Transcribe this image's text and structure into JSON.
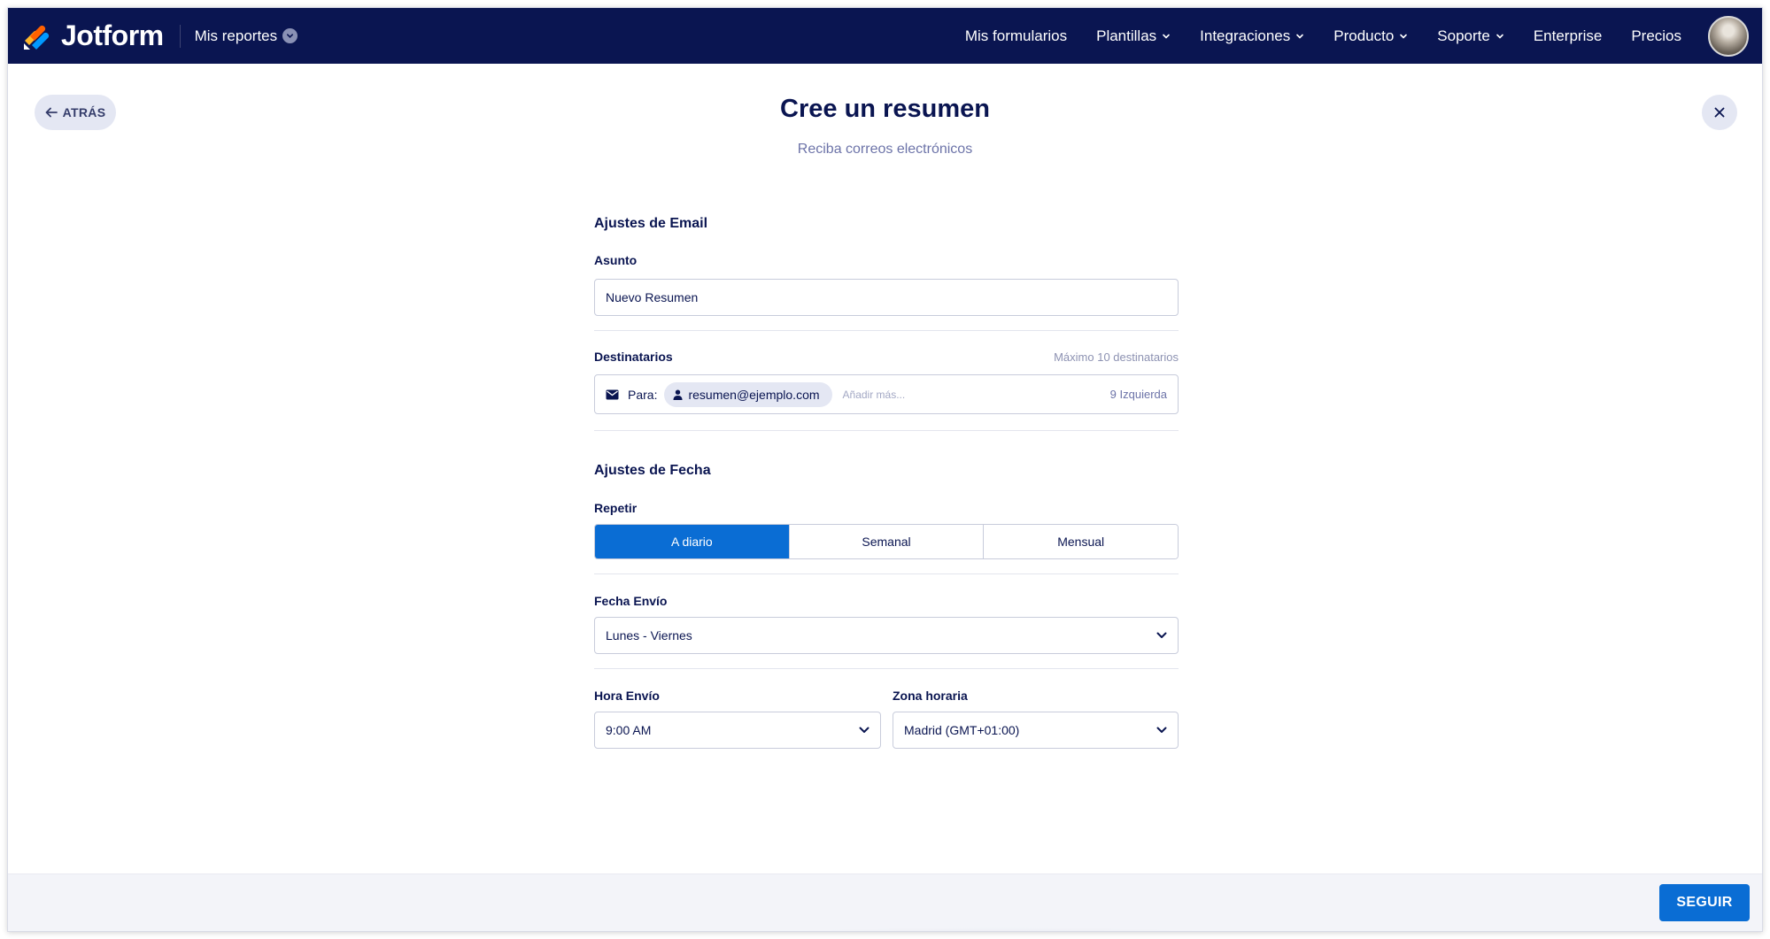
{
  "navbar": {
    "brand": "Jotform",
    "reports_label": "Mis reportes",
    "links": [
      {
        "label": "Mis formularios",
        "has_dropdown": false
      },
      {
        "label": "Plantillas",
        "has_dropdown": true
      },
      {
        "label": "Integraciones",
        "has_dropdown": true
      },
      {
        "label": "Producto",
        "has_dropdown": true
      },
      {
        "label": "Soporte",
        "has_dropdown": true
      },
      {
        "label": "Enterprise",
        "has_dropdown": false
      },
      {
        "label": "Precios",
        "has_dropdown": false
      }
    ]
  },
  "header": {
    "back_label": "ATRÁS",
    "title": "Cree un resumen",
    "subtitle": "Reciba correos electrónicos"
  },
  "email_settings": {
    "section_title": "Ajustes de Email",
    "subject_label": "Asunto",
    "subject_value": "Nuevo Resumen",
    "recipients_label": "Destinatarios",
    "recipients_hint": "Máximo 10 destinatarios",
    "to_label": "Para:",
    "recipient_chip": "resumen@ejemplo.com",
    "add_more_placeholder": "Añadir más...",
    "remaining": "9 Izquierda"
  },
  "date_settings": {
    "section_title": "Ajustes de Fecha",
    "repeat_label": "Repetir",
    "repeat_options": [
      "A diario",
      "Semanal",
      "Mensual"
    ],
    "repeat_selected": "A diario",
    "send_date_label": "Fecha Envío",
    "send_date_value": "Lunes - Viernes",
    "send_time_label": "Hora Envío",
    "send_time_value": "9:00 AM",
    "timezone_label": "Zona horaria",
    "timezone_value": "Madrid (GMT+01:00)"
  },
  "footer": {
    "next_label": "SEGUIR"
  },
  "colors": {
    "navbar_bg": "#0a1551",
    "primary_blue": "#0a6dd4",
    "chip_bg": "#e4e7f3",
    "logo_orange": "#ff6100",
    "logo_yellow": "#ffb629",
    "logo_blue": "#0099ff"
  }
}
